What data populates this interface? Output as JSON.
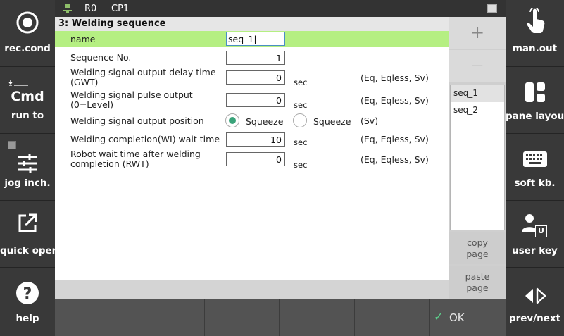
{
  "status": {
    "robot": "R0",
    "cp": "CP1"
  },
  "left_buttons": [
    {
      "id": "rec-cond",
      "label": "rec.cond"
    },
    {
      "id": "cmd-run-to",
      "label": "run to",
      "icon_text": "Cmd"
    },
    {
      "id": "jog-inch",
      "label": "jog inch."
    },
    {
      "id": "quick-open",
      "label": "quick open"
    },
    {
      "id": "help",
      "label": "help"
    }
  ],
  "right_buttons": [
    {
      "id": "man-out",
      "label": "man.out"
    },
    {
      "id": "pane-layout",
      "label": "pane layout"
    },
    {
      "id": "soft-kb",
      "label": "soft kb."
    },
    {
      "id": "user-key",
      "label": "user key",
      "icon_text": "U"
    },
    {
      "id": "prev-next",
      "label": "prev/next"
    }
  ],
  "form": {
    "title": "3: Welding sequence",
    "name_label": "name",
    "name_value": "seq_1|",
    "seq_no_label": "Sequence No.",
    "seq_no_value": "1",
    "gwt_label": "Welding signal output delay time (GWT)",
    "gwt_value": "0",
    "gwt_unit": "sec",
    "gwt_hint": "(Eq, Eqless, Sv)",
    "pulse_label": "Welding signal pulse output (0=Level)",
    "pulse_value": "0",
    "pulse_unit": "sec",
    "pulse_hint": "(Eq, Eqless, Sv)",
    "position_label": "Welding signal output position",
    "position_option1": "Squeeze",
    "position_option2": "Squeeze",
    "position_selected": 1,
    "position_hint": "(Sv)",
    "wi_label": "Welding completion(WI) wait time",
    "wi_value": "10",
    "wi_unit": "sec",
    "wi_hint": "(Eq, Eqless, Sv)",
    "rwt_label": "Robot wait time after welding completion (RWT)",
    "rwt_value": "0",
    "rwt_unit": "sec",
    "rwt_hint": "(Eq, Eqless, Sv)"
  },
  "sidepanel": {
    "add_symbol": "+",
    "remove_symbol": "—",
    "sequences": [
      "seq_1",
      "seq_2"
    ],
    "selected_index": 0,
    "copy_page": "copy\npage",
    "paste_page": "paste\npage"
  },
  "bottom": {
    "ok_label": "OK"
  },
  "colors": {
    "highlight": "#b5ef82",
    "radio_selected": "#3aa37a",
    "ok_check": "#5ccf8a"
  }
}
